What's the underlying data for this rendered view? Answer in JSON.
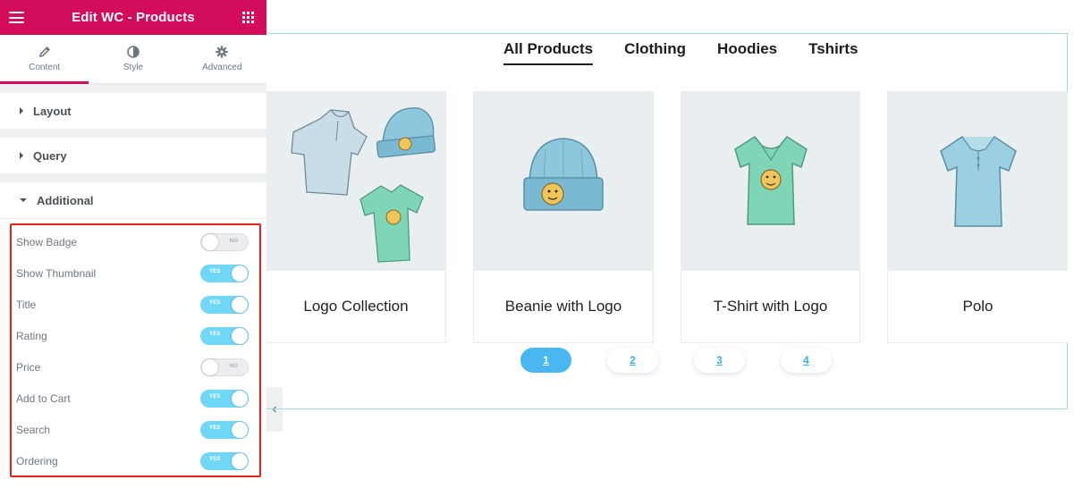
{
  "panel": {
    "title": "Edit WC - Products",
    "tabs": [
      {
        "label": "Content",
        "icon": "pencil-icon"
      },
      {
        "label": "Style",
        "icon": "half-circle-icon"
      },
      {
        "label": "Advanced",
        "icon": "gear-icon"
      }
    ],
    "sections": {
      "layout": "Layout",
      "query": "Query",
      "additional": "Additional"
    },
    "controls": [
      {
        "label": "Show Badge",
        "state": "NO"
      },
      {
        "label": "Show Thumbnail",
        "state": "YES"
      },
      {
        "label": "Title",
        "state": "YES"
      },
      {
        "label": "Rating",
        "state": "YES"
      },
      {
        "label": "Price",
        "state": "NO"
      },
      {
        "label": "Add to Cart",
        "state": "YES"
      },
      {
        "label": "Search",
        "state": "YES"
      },
      {
        "label": "Ordering",
        "state": "YES"
      }
    ]
  },
  "preview": {
    "filters": [
      "All Products",
      "Clothing",
      "Hoodies",
      "Tshirts"
    ],
    "active_filter": "All Products",
    "products": [
      {
        "name": "Logo Collection"
      },
      {
        "name": "Beanie with Logo"
      },
      {
        "name": "T-Shirt with Logo"
      },
      {
        "name": "Polo"
      }
    ],
    "pages": [
      "1",
      "2",
      "3",
      "4"
    ],
    "current_page": "1"
  },
  "colors": {
    "brand": "#d30c5c",
    "switch_on": "#71d7f7",
    "highlight": "#e2231a",
    "page_active": "#4ab8f0"
  }
}
